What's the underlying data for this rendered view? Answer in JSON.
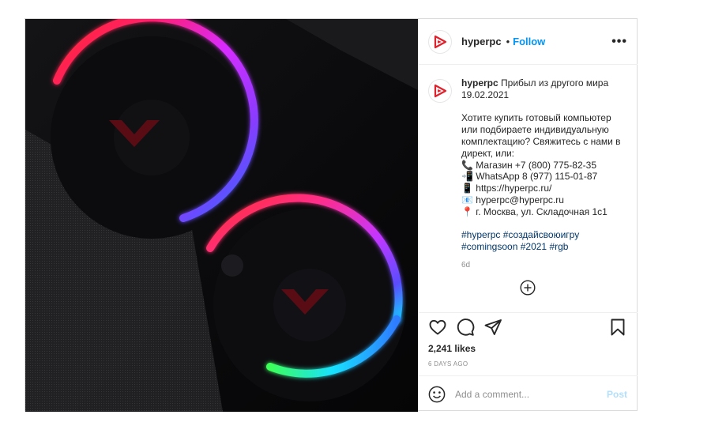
{
  "theme": {
    "link": "#0095f6",
    "hashtag": "#00376b",
    "muted": "#8e8e8e",
    "post_disabled": "#b2dffc"
  },
  "post": {
    "username": "hyperpc",
    "separator": "•",
    "follow_label": "Follow",
    "more_label": "•••",
    "avatar_icon": "hyperpc-logo-icon",
    "image_description_icon": "rgb-fans-photo"
  },
  "caption": {
    "username": "hyperpc",
    "lines_intro": [
      "Прибыл из другого мира",
      "19.02.2021"
    ],
    "lines_body": [
      "Хотите купить готовый компьютер",
      "или подбираете индивидуальную",
      "комплектацию? Свяжитесь с нами в",
      "директ, или:"
    ],
    "contacts": [
      {
        "icon": "📞",
        "text": "Магазин +7 (800) 775-82-35"
      },
      {
        "icon": "📲",
        "text": "WhatsApp 8 (977) 115-01-87"
      },
      {
        "icon": "📱",
        "text": "https://hyperpc.ru/"
      },
      {
        "icon": "📧",
        "text": "hyperpc@hyperpc.ru"
      },
      {
        "icon": "📍",
        "text": "г. Москва, ул. Складочная 1с1"
      }
    ],
    "hashtags_line1": [
      "#hyperpc",
      "#создайсвоюигру"
    ],
    "hashtags_line2": [
      "#comingsoon",
      "#2021",
      "#rgb"
    ],
    "age": "6d"
  },
  "stats": {
    "likes": "2,241 likes",
    "posted": "6 DAYS AGO"
  },
  "comment_box": {
    "placeholder": "Add a comment...",
    "post_label": "Post"
  }
}
